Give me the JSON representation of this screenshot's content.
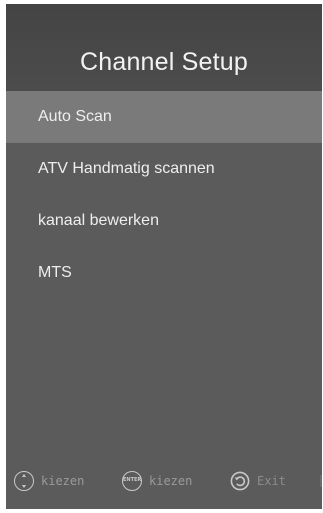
{
  "title": "Channel Setup",
  "menu": [
    {
      "label": "Auto Scan",
      "selected": true
    },
    {
      "label": "ATV Handmatig scannen",
      "selected": false
    },
    {
      "label": "kanaal bewerken",
      "selected": false
    },
    {
      "label": "MTS",
      "selected": false
    }
  ],
  "footer": {
    "navigate_label": "kiezen",
    "navigate_icon": "navigate-up-down-icon",
    "enter_label": "kiezen",
    "enter_icon": "enter-icon",
    "enter_icon_text": "ENTER",
    "exit_label": "Exit",
    "exit_icon": "return-icon"
  },
  "colors": {
    "background": "#5b5b5b",
    "header": "#444444",
    "selected_row": "#7a7a7a",
    "text": "#eeeeee",
    "footer_text": "#9a9a9a"
  }
}
